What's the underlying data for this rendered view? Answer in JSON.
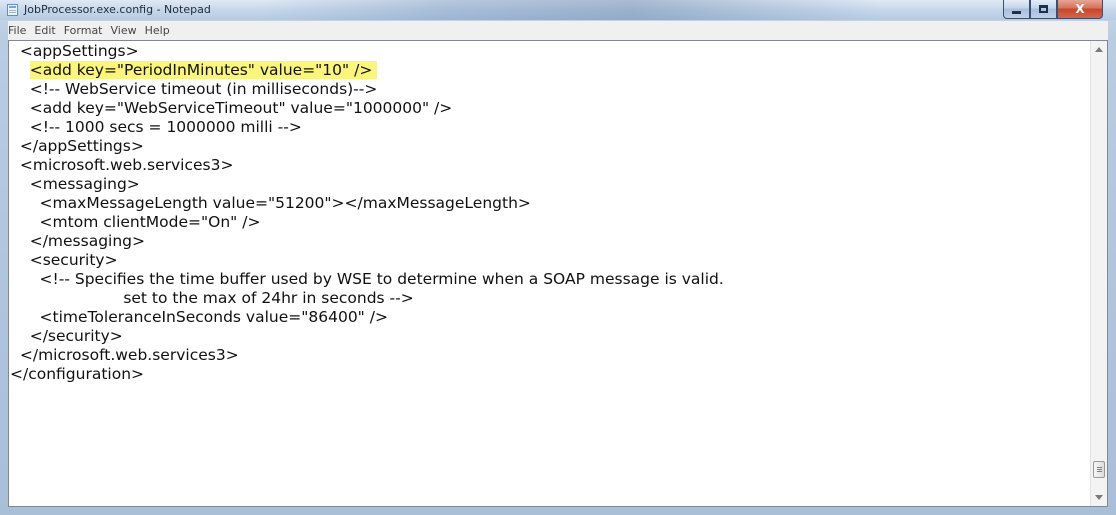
{
  "window": {
    "title": "JobProcessor.exe.config - Notepad"
  },
  "caption_buttons": {
    "close_label": "X"
  },
  "menu": [
    "File",
    "Edit",
    "Format",
    "View",
    "Help"
  ],
  "highlight_color": "#fbf57b",
  "lines": [
    "  <appSettings>",
    "    <add key=\"PeriodInMinutes\" value=\"10\" />",
    "    <!-- WebService timeout (in milliseconds)-->",
    "    <add key=\"WebServiceTimeout\" value=\"1000000\" />",
    "    <!-- 1000 secs = 1000000 milli -->",
    "  </appSettings>",
    "  <microsoft.web.services3>",
    "    <messaging>",
    "      <maxMessageLength value=\"51200\"></maxMessageLength>",
    "      <mtom clientMode=\"On\" />",
    "    </messaging>",
    "    <security>",
    "      <!-- Specifies the time buffer used by WSE to determine when a SOAP message is valid.",
    "                       set to the max of 24hr in seconds -->",
    "      <timeToleranceInSeconds value=\"86400\" />",
    "    </security>",
    "  </microsoft.web.services3>",
    "</configuration>"
  ],
  "highlighted_line_index": 1
}
